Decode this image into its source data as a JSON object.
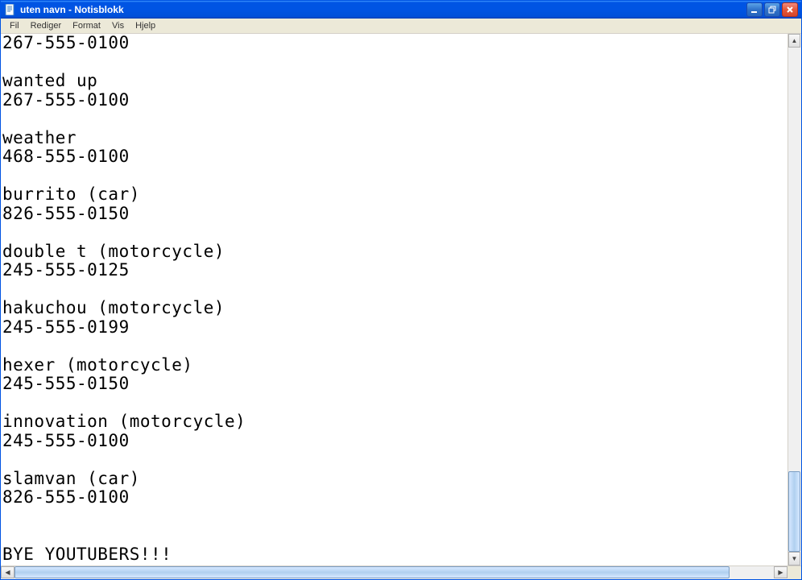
{
  "window": {
    "title": "uten navn - Notisblokk"
  },
  "menu": {
    "fil": "Fil",
    "rediger": "Rediger",
    "format": "Format",
    "vis": "Vis",
    "hjelp": "Hjelp"
  },
  "content": "267-555-0100\n\nwanted up\n267-555-0100\n\nweather\n468-555-0100\n\nburrito (car)\n826-555-0150\n\ndouble t (motorcycle)\n245-555-0125\n\nhakuchou (motorcycle)\n245-555-0199\n\nhexer (motorcycle)\n245-555-0150\n\ninnovation (motorcycle)\n245-555-0100\n\nslamvan (car)\n826-555-0100\n\n\nBYE YOUTUBERS!!!"
}
